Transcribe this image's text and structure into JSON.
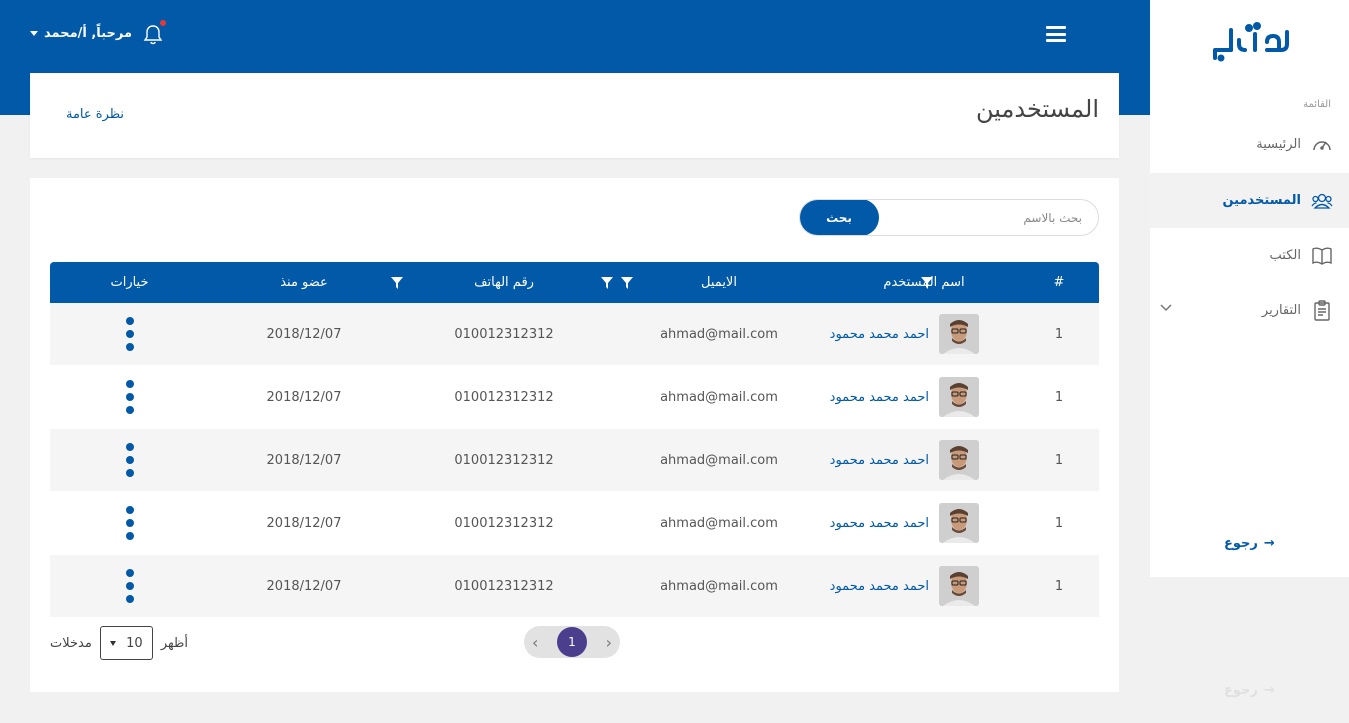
{
  "topbar": {
    "greeting": "مرحباً, أ/محمد",
    "accent_color": "#0159a7",
    "notification_badge_color": "#e53935"
  },
  "header": {
    "title": "المستخدمين",
    "overview_link": "نظرة عامة"
  },
  "search": {
    "placeholder": "بحث بالاسم",
    "button_label": "بحث"
  },
  "table": {
    "columns": {
      "num": "#",
      "name": "اسم المستخدم",
      "email": "الايميل",
      "phone": "رقم الهاتف",
      "member_since": "عضو منذ",
      "options": "خيارات"
    },
    "rows": [
      {
        "num": "1",
        "name": "احمد محمد محمود",
        "email": "ahmad@mail.com",
        "phone": "010012312312",
        "date": "2018/12/07"
      },
      {
        "num": "1",
        "name": "احمد محمد محمود",
        "email": "ahmad@mail.com",
        "phone": "010012312312",
        "date": "2018/12/07"
      },
      {
        "num": "1",
        "name": "احمد محمد محمود",
        "email": "ahmad@mail.com",
        "phone": "010012312312",
        "date": "2018/12/07"
      },
      {
        "num": "1",
        "name": "احمد محمد محمود",
        "email": "ahmad@mail.com",
        "phone": "010012312312",
        "date": "2018/12/07"
      },
      {
        "num": "1",
        "name": "احمد محمد محمود",
        "email": "ahmad@mail.com",
        "phone": "010012312312",
        "date": "2018/12/07"
      }
    ]
  },
  "pagination": {
    "current_page": "1",
    "prev": "‹",
    "next": "›"
  },
  "entries": {
    "show_label": "أظهر",
    "value": "10",
    "suffix": "مدخلات"
  },
  "sidebar": {
    "menu_label": "القائمة",
    "items": [
      {
        "label": "الرئيسية",
        "icon": "speedometer-icon"
      },
      {
        "label": "المستخدمين",
        "icon": "users-icon"
      },
      {
        "label": "الكتب",
        "icon": "book-icon"
      },
      {
        "label": "التقارير",
        "icon": "clipboard-icon"
      }
    ],
    "back_label": "رجوع",
    "ghost_back_label": "رجوع"
  }
}
